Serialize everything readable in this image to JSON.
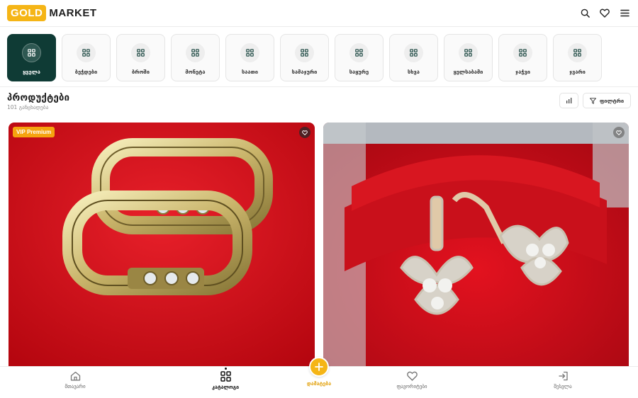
{
  "header": {
    "logo_gold": "GOLD",
    "logo_market": "MARKET",
    "icons": [
      "search-icon",
      "heart-icon",
      "menu-icon"
    ]
  },
  "categories": [
    {
      "label": "ყველა",
      "active": true
    },
    {
      "label": "ბეჭდები",
      "active": false
    },
    {
      "label": "ბროში",
      "active": false
    },
    {
      "label": "მონეტა",
      "active": false
    },
    {
      "label": "საათი",
      "active": false
    },
    {
      "label": "სამაჯური",
      "active": false
    },
    {
      "label": "საყურე",
      "active": false
    },
    {
      "label": "სხვა",
      "active": false
    },
    {
      "label": "ყელსაბამი",
      "active": false
    },
    {
      "label": "ჯაჭვი",
      "active": false
    },
    {
      "label": "ჯვარი",
      "active": false
    }
  ],
  "products_section": {
    "title": "პროდუქტები",
    "count": "101 განცხადება",
    "filter_label": "ფილტრი"
  },
  "products": [
    {
      "badge": "VIP Premium",
      "image": "gold-rings-on-red-velvet"
    },
    {
      "badge": "",
      "image": "butterfly-earrings-in-red-box"
    }
  ],
  "bottom_nav": {
    "home": "მთავარი",
    "catalog": "კატალოგი",
    "add": "დამატება",
    "favorites": "ფავორიტები",
    "login": "შესვლა"
  },
  "colors": {
    "accent": "#f5b516",
    "active_category": "#0f3b35",
    "vip_badge": "#f5a40f"
  }
}
